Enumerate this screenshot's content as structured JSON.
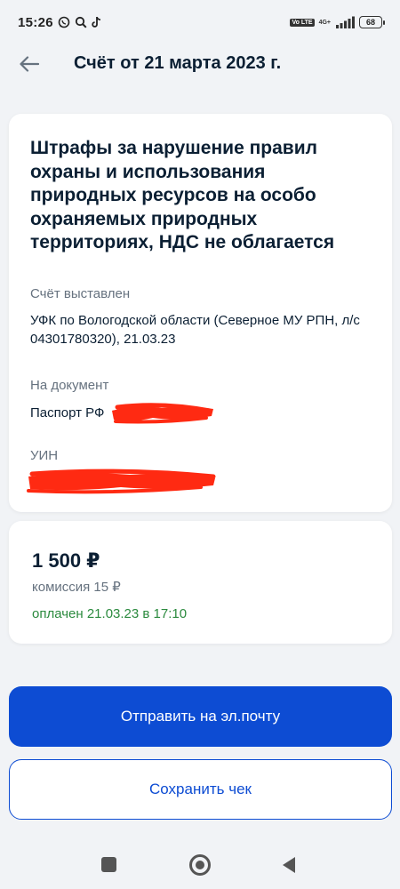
{
  "status_bar": {
    "time": "15:26",
    "network_vo": "Vo LTE",
    "network_4g": "4G+",
    "battery": "68"
  },
  "header": {
    "title": "Счёт от 21 марта 2023 г."
  },
  "invoice": {
    "service_title": "Штрафы за нарушение правил охраны и использования природных ресурсов на особо охраняемых природных территориях, НДС не облагается",
    "issued_label": "Счёт выставлен",
    "issued_value": "УФК по Вологодской области (Северное МУ РПН, л/с 04301780320), 21.03.23",
    "document_label": "На документ",
    "document_value": "Паспорт РФ",
    "uin_label": "УИН"
  },
  "payment": {
    "amount": "1 500 ₽",
    "commission": "комиссия 15 ₽",
    "status": "оплачен 21.03.23 в 17:10"
  },
  "actions": {
    "send_email": "Отправить на эл.почту",
    "save_receipt": "Сохранить чек"
  },
  "colors": {
    "primary": "#0d4cd3",
    "paid_status": "#2b8a3e",
    "redaction": "#ff2a12",
    "background": "#f1f3f6"
  },
  "icons": {
    "back": "arrow-left-icon",
    "whatsapp": "whatsapp-icon",
    "search": "search-icon",
    "tiktok": "tiktok-icon",
    "signal": "signal-icon",
    "battery": "battery-icon"
  }
}
